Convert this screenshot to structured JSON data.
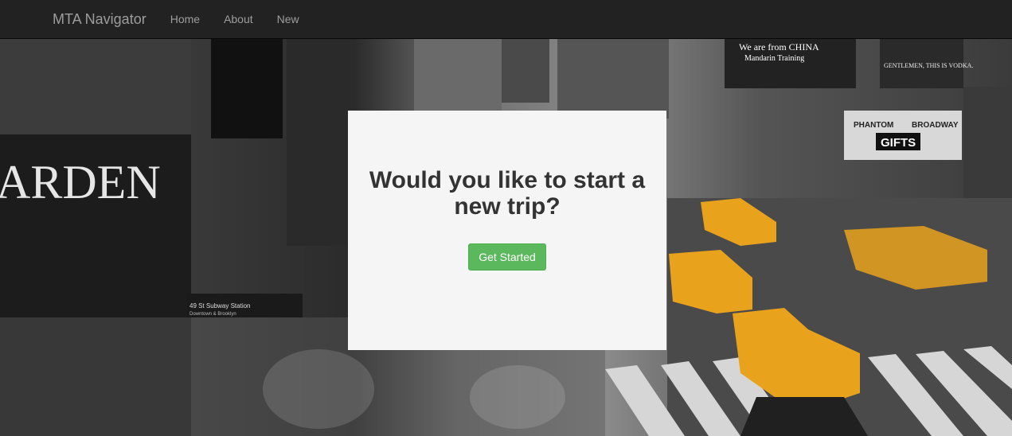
{
  "navbar": {
    "brand": "MTA Navigator",
    "links": [
      "Home",
      "About",
      "New"
    ]
  },
  "hero": {
    "sign_arden": "ARDEN",
    "sign_china": "We are from CHINA",
    "sign_mandarin": "Mandarin Training",
    "sign_vodka": "GENTLEMEN, THIS IS VODKA.",
    "sign_gifts": "GIFTS",
    "sign_phantom": "PHANTOM",
    "sign_broadway": "BROADWAY",
    "sign_subway": "49 St Subway Station",
    "sign_subway_sub": "Downtown & Brooklyn"
  },
  "card": {
    "heading": "Would you like to start a new trip?",
    "button_label": "Get Started"
  },
  "colors": {
    "navbar_bg": "#222222",
    "nav_text": "#9d9d9d",
    "button_green": "#5cb85c",
    "taxi_yellow": "#e8a21c"
  }
}
